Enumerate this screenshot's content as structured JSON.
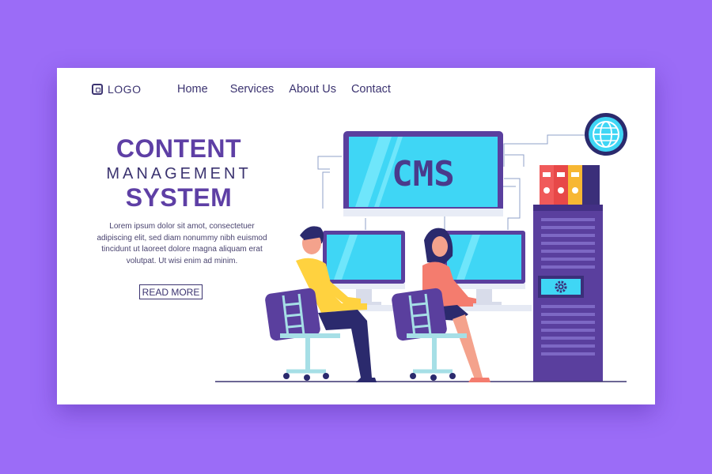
{
  "brand": {
    "logo_text": "LOGO"
  },
  "nav": {
    "items": [
      "Home",
      "Services",
      "About Us",
      "Contact"
    ]
  },
  "hero": {
    "title_line1": "CONTENT",
    "title_line2": "MANAGEMENT",
    "title_line3": "SYSTEM",
    "description": "Lorem ipsum dolor sit amot, consectetuer adipiscing elit, sed diam nonummy nibh euismod tincidunt ut laoreet dolore magna aliquam erat volutpat. Ut wisi enim ad minim.",
    "cta_label": "READ MORE"
  },
  "illustration": {
    "monitor_text": "CMS"
  },
  "colors": {
    "background": "#9b6cf7",
    "primary": "#5e3fa5",
    "dark": "#3b3370",
    "screen": "#3fd6f5",
    "server": "#5a3f9e"
  }
}
